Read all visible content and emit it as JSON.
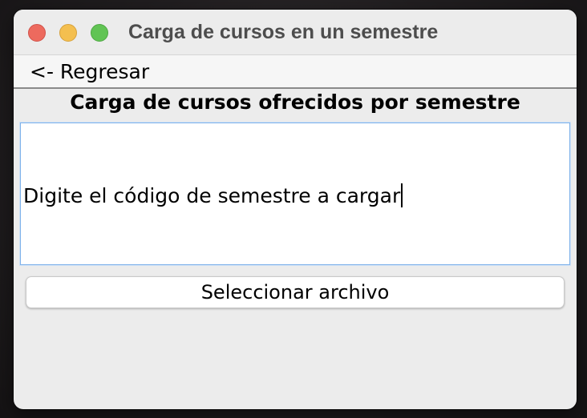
{
  "window": {
    "title": "Carga de cursos en un semestre",
    "controls": [
      "close",
      "minimize",
      "zoom"
    ],
    "colors": {
      "close": "#ed6a5e",
      "minimize": "#f4bf4f",
      "zoom": "#61c454"
    }
  },
  "menu": {
    "back_label": "<- Regresar"
  },
  "main": {
    "heading": "Carga de cursos ofrecidos por semestre",
    "code_field": {
      "value": "Digite el código de semestre a cargar",
      "focused": true
    },
    "select_file_label": "Seleccionar archivo"
  },
  "colors": {
    "focus_ring": "#7fb2ea",
    "window_bg": "#ececec"
  }
}
